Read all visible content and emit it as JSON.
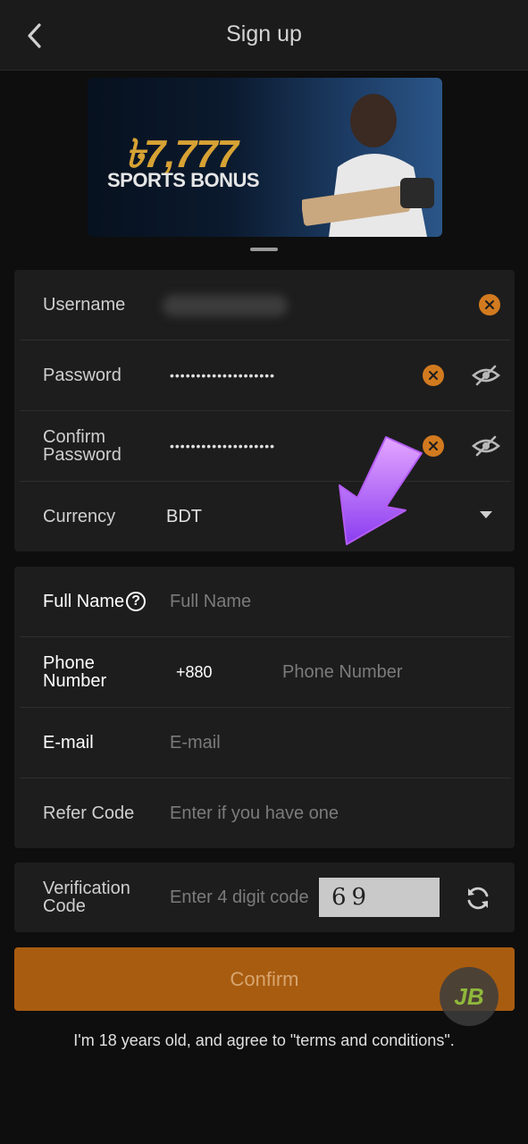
{
  "header": {
    "title": "Sign up",
    "back_icon": "chevron-left-icon"
  },
  "banner": {
    "amount": "৳7,777",
    "subtitle": "SPORTS BONUS"
  },
  "account": {
    "username": {
      "label": "Username"
    },
    "password": {
      "label": "Password",
      "value": "••••••••••••••••••••"
    },
    "confirm_password": {
      "label_line1": "Confirm",
      "label_line2": "Password",
      "value": "••••••••••••••••••••"
    },
    "currency": {
      "label": "Currency",
      "value": "BDT"
    }
  },
  "personal": {
    "full_name": {
      "label": "Full Name",
      "placeholder": "Full Name"
    },
    "phone": {
      "label_line1": "Phone",
      "label_line2": "Number",
      "prefix": "+880",
      "placeholder": "Phone Number"
    },
    "email": {
      "label": "E-mail",
      "placeholder": "E-mail"
    },
    "refer": {
      "label": "Refer Code",
      "placeholder": "Enter if you have one"
    }
  },
  "verification": {
    "label_line1": "Verification",
    "label_line2": "Code",
    "placeholder": "Enter 4 digit code",
    "captcha": "69"
  },
  "confirm_label": "Confirm",
  "terms": "I'm 18 years old, and agree to \"terms and conditions\".",
  "fab": {
    "logo_text": "JB"
  },
  "colors": {
    "accent": "#d27a1f",
    "button": "#a85c10",
    "background": "#0e0e0e",
    "card": "#1d1d1d"
  }
}
